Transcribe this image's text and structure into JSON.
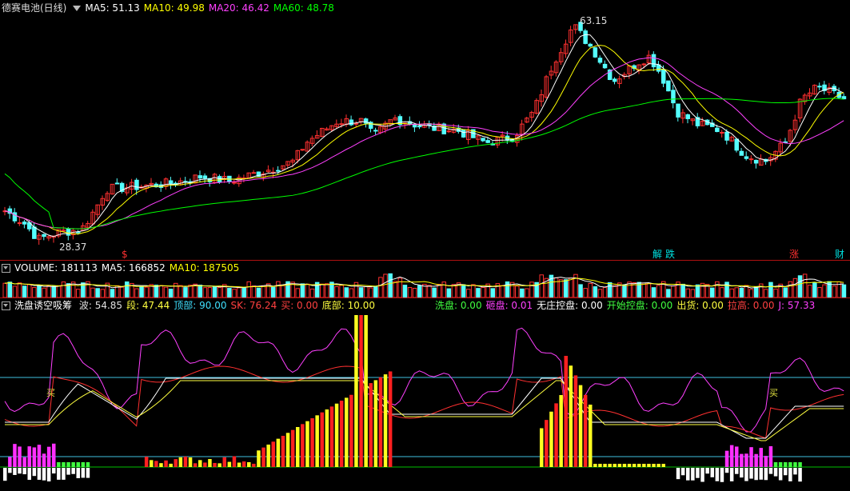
{
  "price": {
    "title": "德赛电池(日线)",
    "ma5": "MA5: 51.13",
    "ma10": "MA10: 49.98",
    "ma20": "MA20: 46.42",
    "ma60": "MA60: 48.78",
    "high_label": "63.15",
    "low_label": "28.37",
    "events": [
      {
        "text": "$",
        "color": "#ff3030"
      },
      {
        "text": "解",
        "color": "#00e0e0"
      },
      {
        "text": "跌",
        "color": "#00e0e0"
      },
      {
        "text": "涨",
        "color": "#ff3030"
      },
      {
        "text": "财",
        "color": "#00e0e0"
      }
    ]
  },
  "volume": {
    "label": "VOLUME: 181113",
    "ma5": "MA5: 166852",
    "ma10": "MA10: 187505"
  },
  "indicator": {
    "title": "洗盘诱空吸筹",
    "items": [
      {
        "text": "波: 54.85",
        "color": "#e0e0e0"
      },
      {
        "text": "段: 47.44",
        "color": "#ffff40"
      },
      {
        "text": "顶部: 90.00",
        "color": "#40e0ff"
      },
      {
        "text": "SK: 76.24",
        "color": "#ff4040"
      },
      {
        "text": "买: 0.00",
        "color": "#ff4040"
      },
      {
        "text": "底部: 10.00",
        "color": "#ffff40"
      },
      {
        "text": "洗盘: 0.00",
        "color": "#40ff40"
      },
      {
        "text": "砸盘: 0.01",
        "color": "#ff40ff"
      },
      {
        "text": "无庄控盘: 0.00",
        "color": "#ffffff"
      },
      {
        "text": "开始控盘: 0.00",
        "color": "#40ff40"
      },
      {
        "text": "出货: 0.00",
        "color": "#ffff40"
      },
      {
        "text": "拉高: 0.00",
        "color": "#ff4040"
      },
      {
        "text": "J: 57.33",
        "color": "#ff40ff"
      }
    ],
    "buy_signals": [
      "买",
      "买"
    ]
  },
  "colors": {
    "up": "#ff3030",
    "down": "#54ffff",
    "ma5": "#ffffff",
    "ma10": "#ffff00",
    "ma20": "#ff40ff",
    "ma60": "#00ff00",
    "panel_border": "#b01010"
  }
}
